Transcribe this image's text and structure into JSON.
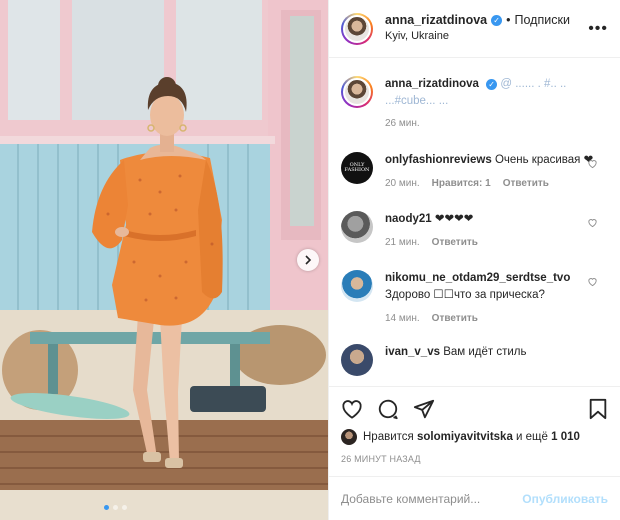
{
  "post": {
    "author": "anna_rizatdinova",
    "separator": "•",
    "follow_label": "Подписки",
    "location": "Kyiv, Ukraine",
    "more_icon": "more-dots-icon"
  },
  "comments": [
    {
      "user": "anna_rizatdinova",
      "text": "@ ...... . #.. .. ...#cube... ...",
      "time": "26 мин.",
      "likes": "",
      "reply": ""
    },
    {
      "user": "onlyfashionreviews",
      "text": "Очень красивая ❤",
      "time": "20 мин.",
      "likes": "Нравится: 1",
      "reply": "Ответить"
    },
    {
      "user": "naody21",
      "text": "❤❤❤❤",
      "time": "21 мин.",
      "likes": "",
      "reply": "Ответить"
    },
    {
      "user": "nikomu_ne_otdam29_serdtse_tvo",
      "text": "Здорово ☐☐что за прическа?",
      "time": "14 мин.",
      "likes": "",
      "reply": "Ответить"
    },
    {
      "user": "ivan_v_vs",
      "text": "Вам идёт стиль",
      "time": "",
      "likes": "",
      "reply": ""
    }
  ],
  "likes": {
    "prefix": "Нравится",
    "user": "solomiyavitvitska",
    "middle": "и ещё",
    "count": "1 010"
  },
  "time_ago": "26 МИНУТ НАЗАД",
  "add_comment": {
    "placeholder": "Добавьте комментарий...",
    "publish_label": "Опубликовать"
  },
  "colors": {
    "accent": "#3897f0",
    "publish_disabled": "#b2dffc",
    "secondary_text": "#8e8e8e",
    "dress": "#ee8a3c"
  },
  "carousel": {
    "slides": 3,
    "active": 1
  }
}
